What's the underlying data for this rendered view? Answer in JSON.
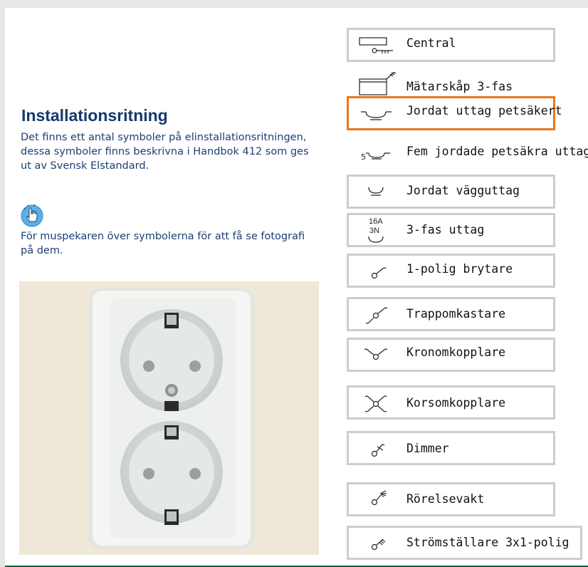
{
  "heading": {
    "title": "Installationsritning",
    "description": "Det finns ett antal symboler på elinstallationsritningen, dessa symboler finns beskrivna i Handbok 412 som ges ut av Svensk Elstandard."
  },
  "hint": {
    "text": "För muspekaren över symbolerna för att få se fotografi på dem."
  },
  "photo": {
    "subject": "double grounded socket outlet",
    "colors": {
      "background": "#efe8d6",
      "socket": "#f4f5f3",
      "shadow": "#cfd3d0"
    }
  },
  "symbols": [
    {
      "label": "Central",
      "icon": "central-symbol-icon",
      "active": false
    },
    {
      "label": "Mätarskåp 3-fas",
      "icon": "meter-cabinet-symbol-icon",
      "active": false
    },
    {
      "label": "Jordat uttag petsäkert",
      "icon": "grounded-outlet-childsafe-symbol-icon",
      "active": true
    },
    {
      "label": "Fem jordade petsäkra uttag",
      "icon": "five-grounded-outlets-symbol-icon",
      "active": false,
      "icon_number": "5"
    },
    {
      "label": "Jordat vägguttag",
      "icon": "grounded-wall-outlet-symbol-icon",
      "active": false
    },
    {
      "label": "3-fas uttag",
      "icon": "three-phase-outlet-symbol-icon",
      "active": false,
      "icon_text_1": "16A",
      "icon_text_2": "3N"
    },
    {
      "label": "1-polig brytare",
      "icon": "single-pole-switch-symbol-icon",
      "active": false
    },
    {
      "label": "Trappomkastare",
      "icon": "two-way-switch-symbol-icon",
      "active": false
    },
    {
      "label": "Kronomkopplare",
      "icon": "series-switch-symbol-icon",
      "active": false
    },
    {
      "label": "Korsomkopplare",
      "icon": "intermediate-switch-symbol-icon",
      "active": false
    },
    {
      "label": "Dimmer",
      "icon": "dimmer-symbol-icon",
      "active": false
    },
    {
      "label": "Rörelsevakt",
      "icon": "motion-sensor-symbol-icon",
      "active": false
    },
    {
      "label": "Strömställare 3x1-polig",
      "icon": "three-pole-switch-symbol-icon",
      "active": false
    }
  ],
  "colors": {
    "accent_selected": "#e8781e",
    "heading": "#17386d",
    "body_text": "#1c3f74",
    "box_border": "#cdcdcd"
  }
}
